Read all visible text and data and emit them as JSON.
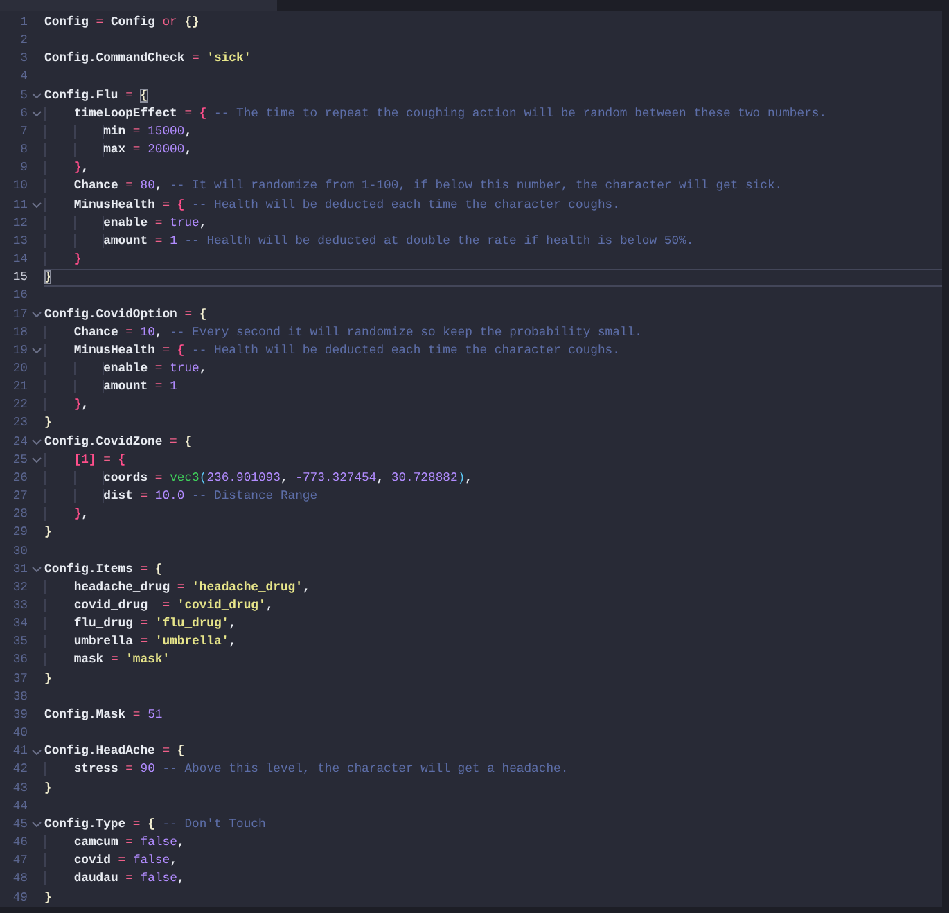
{
  "editor": {
    "lines": [
      {
        "number": "1",
        "fold": false,
        "current": false,
        "tokens": [
          {
            "kind": "ident",
            "text": "Config"
          },
          {
            "kind": "op",
            "text": " = "
          },
          {
            "kind": "ident",
            "text": "Config "
          },
          {
            "kind": "keyword",
            "text": "or"
          },
          {
            "kind": "brace1",
            "text": " {}"
          }
        ]
      },
      {
        "number": "2",
        "fold": false,
        "current": false
      },
      {
        "number": "3",
        "fold": false,
        "current": false,
        "tokens": [
          {
            "kind": "ident",
            "text": "Config.CommandCheck"
          },
          {
            "kind": "op",
            "text": " = "
          },
          {
            "kind": "string",
            "text": "'sick'"
          }
        ]
      },
      {
        "number": "4",
        "fold": false,
        "current": false
      },
      {
        "number": "5",
        "fold": true,
        "current": false,
        "tokens": [
          {
            "kind": "ident",
            "text": "Config.Flu"
          },
          {
            "kind": "op",
            "text": " = "
          },
          {
            "kind": "brace1",
            "text": "{",
            "match": true
          }
        ]
      },
      {
        "number": "6",
        "fold": true,
        "current": false,
        "tokens": [
          {
            "kind": "ident",
            "text": "    timeLoopEffect"
          },
          {
            "kind": "op",
            "text": " = "
          },
          {
            "kind": "brace2",
            "text": "{"
          },
          {
            "kind": "comment",
            "text": " -- The time to repeat the coughing action will be random between these two numbers."
          }
        ]
      },
      {
        "number": "7",
        "fold": false,
        "current": false,
        "tokens": [
          {
            "kind": "ident",
            "text": "        min"
          },
          {
            "kind": "op",
            "text": " = "
          },
          {
            "kind": "number",
            "text": "15000"
          },
          {
            "kind": "punct",
            "text": ","
          }
        ]
      },
      {
        "number": "8",
        "fold": false,
        "current": false,
        "tokens": [
          {
            "kind": "ident",
            "text": "        max"
          },
          {
            "kind": "op",
            "text": " = "
          },
          {
            "kind": "number",
            "text": "20000"
          },
          {
            "kind": "punct",
            "text": ","
          }
        ]
      },
      {
        "number": "9",
        "fold": false,
        "current": false,
        "tokens": [
          {
            "kind": "brace2",
            "text": "    }"
          },
          {
            "kind": "punct",
            "text": ","
          }
        ]
      },
      {
        "number": "10",
        "fold": false,
        "current": false,
        "tokens": [
          {
            "kind": "ident",
            "text": "    Chance"
          },
          {
            "kind": "op",
            "text": " = "
          },
          {
            "kind": "number",
            "text": "80"
          },
          {
            "kind": "punct",
            "text": ","
          },
          {
            "kind": "comment",
            "text": " -- It will randomize from 1-100, if below this number, the character will get sick."
          }
        ]
      },
      {
        "number": "11",
        "fold": true,
        "current": false,
        "tokens": [
          {
            "kind": "ident",
            "text": "    MinusHealth"
          },
          {
            "kind": "op",
            "text": " = "
          },
          {
            "kind": "brace2",
            "text": "{"
          },
          {
            "kind": "comment",
            "text": " -- Health will be deducted each time the character coughs."
          }
        ]
      },
      {
        "number": "12",
        "fold": false,
        "current": false,
        "tokens": [
          {
            "kind": "ident",
            "text": "        enable"
          },
          {
            "kind": "op",
            "text": " = "
          },
          {
            "kind": "bool",
            "text": "true"
          },
          {
            "kind": "punct",
            "text": ","
          }
        ]
      },
      {
        "number": "13",
        "fold": false,
        "current": false,
        "tokens": [
          {
            "kind": "ident",
            "text": "        amount"
          },
          {
            "kind": "op",
            "text": " = "
          },
          {
            "kind": "number",
            "text": "1"
          },
          {
            "kind": "comment",
            "text": " -- Health will be deducted at double the rate if health is below 50%."
          }
        ]
      },
      {
        "number": "14",
        "fold": false,
        "current": false,
        "tokens": [
          {
            "kind": "brace2",
            "text": "    }"
          }
        ]
      },
      {
        "number": "15",
        "fold": false,
        "current": true,
        "tokens": [
          {
            "kind": "brace1",
            "text": "}",
            "match": true
          }
        ]
      },
      {
        "number": "16",
        "fold": false,
        "current": false
      },
      {
        "number": "17",
        "fold": true,
        "current": false,
        "tokens": [
          {
            "kind": "ident",
            "text": "Config.CovidOption"
          },
          {
            "kind": "op",
            "text": " = "
          },
          {
            "kind": "brace1",
            "text": "{"
          }
        ]
      },
      {
        "number": "18",
        "fold": false,
        "current": false,
        "tokens": [
          {
            "kind": "ident",
            "text": "    Chance"
          },
          {
            "kind": "op",
            "text": " = "
          },
          {
            "kind": "number",
            "text": "10"
          },
          {
            "kind": "punct",
            "text": ","
          },
          {
            "kind": "comment",
            "text": " -- Every second it will randomize so keep the probability small."
          }
        ]
      },
      {
        "number": "19",
        "fold": true,
        "current": false,
        "tokens": [
          {
            "kind": "ident",
            "text": "    MinusHealth"
          },
          {
            "kind": "op",
            "text": " = "
          },
          {
            "kind": "brace2",
            "text": "{"
          },
          {
            "kind": "comment",
            "text": " -- Health will be deducted each time the character coughs."
          }
        ]
      },
      {
        "number": "20",
        "fold": false,
        "current": false,
        "tokens": [
          {
            "kind": "ident",
            "text": "        enable"
          },
          {
            "kind": "op",
            "text": " = "
          },
          {
            "kind": "bool",
            "text": "true"
          },
          {
            "kind": "punct",
            "text": ","
          }
        ]
      },
      {
        "number": "21",
        "fold": false,
        "current": false,
        "tokens": [
          {
            "kind": "ident",
            "text": "        amount"
          },
          {
            "kind": "op",
            "text": " = "
          },
          {
            "kind": "number",
            "text": "1"
          }
        ]
      },
      {
        "number": "22",
        "fold": false,
        "current": false,
        "tokens": [
          {
            "kind": "brace2",
            "text": "    }"
          },
          {
            "kind": "punct",
            "text": ","
          }
        ]
      },
      {
        "number": "23",
        "fold": false,
        "current": false,
        "tokens": [
          {
            "kind": "brace1",
            "text": "}"
          }
        ]
      },
      {
        "number": "24",
        "fold": true,
        "current": false,
        "tokens": [
          {
            "kind": "ident",
            "text": "Config.CovidZone"
          },
          {
            "kind": "op",
            "text": " = "
          },
          {
            "kind": "brace1",
            "text": "{"
          }
        ]
      },
      {
        "number": "25",
        "fold": true,
        "current": false,
        "tokens": [
          {
            "kind": "brace2",
            "text": "    [1]"
          },
          {
            "kind": "op",
            "text": " = "
          },
          {
            "kind": "brace2",
            "text": "{"
          }
        ]
      },
      {
        "number": "26",
        "fold": false,
        "current": false,
        "tokens": [
          {
            "kind": "ident",
            "text": "        coords"
          },
          {
            "kind": "op",
            "text": " = "
          },
          {
            "kind": "function",
            "text": "vec3"
          },
          {
            "kind": "paren",
            "text": "("
          },
          {
            "kind": "number",
            "text": "236.901093"
          },
          {
            "kind": "punct",
            "text": ", "
          },
          {
            "kind": "number",
            "text": "-773.327454"
          },
          {
            "kind": "punct",
            "text": ", "
          },
          {
            "kind": "number",
            "text": "30.728882"
          },
          {
            "kind": "paren",
            "text": ")"
          },
          {
            "kind": "punct",
            "text": ","
          }
        ]
      },
      {
        "number": "27",
        "fold": false,
        "current": false,
        "tokens": [
          {
            "kind": "ident",
            "text": "        dist"
          },
          {
            "kind": "op",
            "text": " = "
          },
          {
            "kind": "number",
            "text": "10.0"
          },
          {
            "kind": "comment",
            "text": " -- Distance Range"
          }
        ]
      },
      {
        "number": "28",
        "fold": false,
        "current": false,
        "tokens": [
          {
            "kind": "brace2",
            "text": "    }"
          },
          {
            "kind": "punct",
            "text": ","
          }
        ]
      },
      {
        "number": "29",
        "fold": false,
        "current": false,
        "tokens": [
          {
            "kind": "brace1",
            "text": "}"
          }
        ]
      },
      {
        "number": "30",
        "fold": false,
        "current": false
      },
      {
        "number": "31",
        "fold": true,
        "current": false,
        "tokens": [
          {
            "kind": "ident",
            "text": "Config.Items"
          },
          {
            "kind": "op",
            "text": " = "
          },
          {
            "kind": "brace1",
            "text": "{"
          }
        ]
      },
      {
        "number": "32",
        "fold": false,
        "current": false,
        "tokens": [
          {
            "kind": "ident",
            "text": "    headache_drug"
          },
          {
            "kind": "op",
            "text": " = "
          },
          {
            "kind": "string",
            "text": "'headache_drug'"
          },
          {
            "kind": "punct",
            "text": ","
          }
        ]
      },
      {
        "number": "33",
        "fold": false,
        "current": false,
        "tokens": [
          {
            "kind": "ident",
            "text": "    covid_drug"
          },
          {
            "kind": "op",
            "text": "  = "
          },
          {
            "kind": "string",
            "text": "'covid_drug'"
          },
          {
            "kind": "punct",
            "text": ","
          }
        ]
      },
      {
        "number": "34",
        "fold": false,
        "current": false,
        "tokens": [
          {
            "kind": "ident",
            "text": "    flu_drug"
          },
          {
            "kind": "op",
            "text": " = "
          },
          {
            "kind": "string",
            "text": "'flu_drug'"
          },
          {
            "kind": "punct",
            "text": ","
          }
        ]
      },
      {
        "number": "35",
        "fold": false,
        "current": false,
        "tokens": [
          {
            "kind": "ident",
            "text": "    umbrella"
          },
          {
            "kind": "op",
            "text": " = "
          },
          {
            "kind": "string",
            "text": "'umbrella'"
          },
          {
            "kind": "punct",
            "text": ","
          }
        ]
      },
      {
        "number": "36",
        "fold": false,
        "current": false,
        "tokens": [
          {
            "kind": "ident",
            "text": "    mask"
          },
          {
            "kind": "op",
            "text": " = "
          },
          {
            "kind": "string",
            "text": "'mask'"
          }
        ]
      },
      {
        "number": "37",
        "fold": false,
        "current": false,
        "tokens": [
          {
            "kind": "brace1",
            "text": "}"
          }
        ]
      },
      {
        "number": "38",
        "fold": false,
        "current": false
      },
      {
        "number": "39",
        "fold": false,
        "current": false,
        "tokens": [
          {
            "kind": "ident",
            "text": "Config.Mask"
          },
          {
            "kind": "op",
            "text": " = "
          },
          {
            "kind": "number",
            "text": "51"
          }
        ]
      },
      {
        "number": "40",
        "fold": false,
        "current": false
      },
      {
        "number": "41",
        "fold": true,
        "current": false,
        "tokens": [
          {
            "kind": "ident",
            "text": "Config.HeadAche"
          },
          {
            "kind": "op",
            "text": " = "
          },
          {
            "kind": "brace1",
            "text": "{"
          }
        ]
      },
      {
        "number": "42",
        "fold": false,
        "current": false,
        "tokens": [
          {
            "kind": "ident",
            "text": "    stress"
          },
          {
            "kind": "op",
            "text": " = "
          },
          {
            "kind": "number",
            "text": "90"
          },
          {
            "kind": "comment",
            "text": " -- Above this level, the character will get a headache."
          }
        ]
      },
      {
        "number": "43",
        "fold": false,
        "current": false,
        "tokens": [
          {
            "kind": "brace1",
            "text": "}"
          }
        ]
      },
      {
        "number": "44",
        "fold": false,
        "current": false
      },
      {
        "number": "45",
        "fold": true,
        "current": false,
        "tokens": [
          {
            "kind": "ident",
            "text": "Config.Type"
          },
          {
            "kind": "op",
            "text": " = "
          },
          {
            "kind": "brace1",
            "text": "{"
          },
          {
            "kind": "comment",
            "text": " -- Don't Touch"
          }
        ]
      },
      {
        "number": "46",
        "fold": false,
        "current": false,
        "tokens": [
          {
            "kind": "ident",
            "text": "    camcum"
          },
          {
            "kind": "op",
            "text": " = "
          },
          {
            "kind": "bool",
            "text": "false"
          },
          {
            "kind": "punct",
            "text": ","
          }
        ]
      },
      {
        "number": "47",
        "fold": false,
        "current": false,
        "tokens": [
          {
            "kind": "ident",
            "text": "    covid"
          },
          {
            "kind": "op",
            "text": " = "
          },
          {
            "kind": "bool",
            "text": "false"
          },
          {
            "kind": "punct",
            "text": ","
          }
        ]
      },
      {
        "number": "48",
        "fold": false,
        "current": false,
        "tokens": [
          {
            "kind": "ident",
            "text": "    daudau"
          },
          {
            "kind": "op",
            "text": " = "
          },
          {
            "kind": "bool",
            "text": "false"
          },
          {
            "kind": "punct",
            "text": ","
          }
        ]
      },
      {
        "number": "49",
        "fold": false,
        "current": false,
        "tokens": [
          {
            "kind": "brace1",
            "text": "}"
          }
        ]
      }
    ]
  }
}
